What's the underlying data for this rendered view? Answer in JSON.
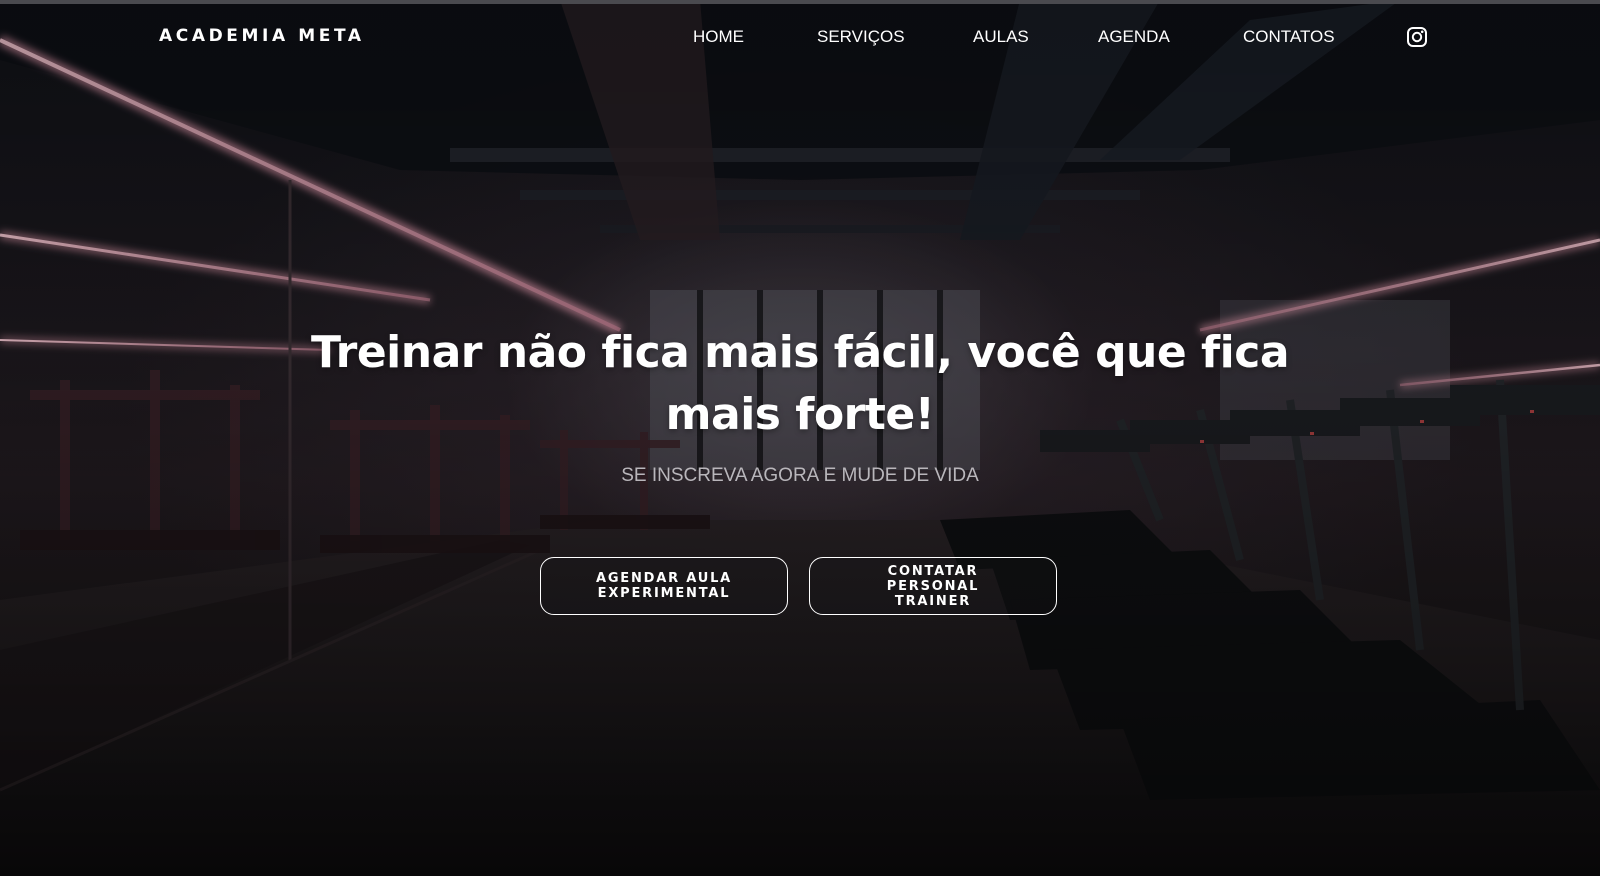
{
  "header": {
    "brand": "ACADEMIA META",
    "nav": [
      {
        "label": "HOME"
      },
      {
        "label": "SERVIÇOS"
      },
      {
        "label": "AULAS"
      },
      {
        "label": "AGENDA"
      },
      {
        "label": "CONTATOS"
      }
    ],
    "social_icon": "instagram-icon"
  },
  "hero": {
    "title": "Treinar não fica mais fácil, você que fica mais forte!",
    "subtitle": "SE INSCREVA AGORA E MUDE DE VIDA",
    "buttons": [
      {
        "label": "AGENDAR AULA EXPERIMENTAL"
      },
      {
        "label": "CONTATAR PERSONAL TRAINER"
      }
    ]
  },
  "colors": {
    "text": "#ffffff",
    "subtitle": "#b9b6bb",
    "neon": "#e2a3b2",
    "background": "#141214"
  }
}
